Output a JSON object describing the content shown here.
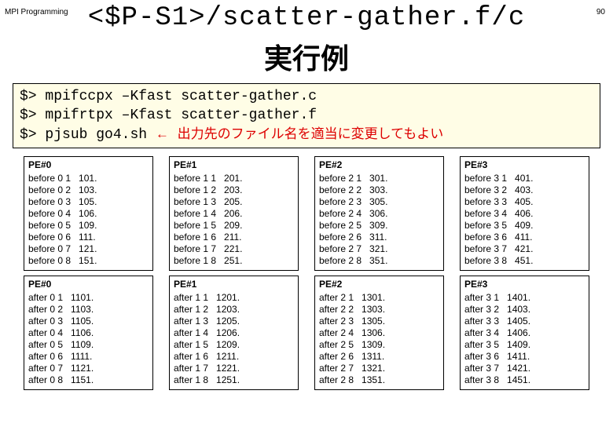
{
  "header": {
    "label": "MPI Programming",
    "page_number": "90"
  },
  "title": {
    "path": "<$P-S1>/scatter-gather.f/c",
    "jp": "実行例"
  },
  "commands": {
    "l1_prompt": "$>",
    "l1_cmd": "mpifccpx –Kfast scatter-gather.c",
    "l2_prompt": "$>",
    "l2_cmd": "mpifrtpx –Kfast scatter-gather.f",
    "l3_prompt": "$>",
    "l3_cmd": "pjsub go4.sh",
    "l3_arrow": "←",
    "l3_note": "出力先のファイル名を適当に変更してもよい"
  },
  "before": {
    "pe0": {
      "title": "PE#0",
      "rows": [
        "before 0 1   101.",
        "before 0 2   103.",
        "before 0 3   105.",
        "before 0 4   106.",
        "before 0 5   109.",
        "before 0 6   111.",
        "before 0 7   121.",
        "before 0 8   151."
      ]
    },
    "pe1": {
      "title": "PE#1",
      "rows": [
        "before 1 1   201.",
        "before 1 2   203.",
        "before 1 3   205.",
        "before 1 4   206.",
        "before 1 5   209.",
        "before 1 6   211.",
        "before 1 7   221.",
        "before 1 8   251."
      ]
    },
    "pe2": {
      "title": "PE#2",
      "rows": [
        "before 2 1   301.",
        "before 2 2   303.",
        "before 2 3   305.",
        "before 2 4   306.",
        "before 2 5   309.",
        "before 2 6   311.",
        "before 2 7   321.",
        "before 2 8   351."
      ]
    },
    "pe3": {
      "title": "PE#3",
      "rows": [
        "before 3 1   401.",
        "before 3 2   403.",
        "before 3 3   405.",
        "before 3 4   406.",
        "before 3 5   409.",
        "before 3 6   411.",
        "before 3 7   421.",
        "before 3 8   451."
      ]
    }
  },
  "after": {
    "pe0": {
      "title": "PE#0",
      "rows": [
        "after 0 1   1101.",
        "after 0 2   1103.",
        "after 0 3   1105.",
        "after 0 4   1106.",
        "after 0 5   1109.",
        "after 0 6   1111.",
        "after 0 7   1121.",
        "after 0 8   1151."
      ]
    },
    "pe1": {
      "title": "PE#1",
      "rows": [
        "after 1 1   1201.",
        "after 1 2   1203.",
        "after 1 3   1205.",
        "after 1 4   1206.",
        "after 1 5   1209.",
        "after 1 6   1211.",
        "after 1 7   1221.",
        "after 1 8   1251."
      ]
    },
    "pe2": {
      "title": "PE#2",
      "rows": [
        "after 2 1   1301.",
        "after 2 2   1303.",
        "after 2 3   1305.",
        "after 2 4   1306.",
        "after 2 5   1309.",
        "after 2 6   1311.",
        "after 2 7   1321.",
        "after 2 8   1351."
      ]
    },
    "pe3": {
      "title": "PE#3",
      "rows": [
        "after 3 1   1401.",
        "after 3 2   1403.",
        "after 3 3   1405.",
        "after 3 4   1406.",
        "after 3 5   1409.",
        "after 3 6   1411.",
        "after 3 7   1421.",
        "after 3 8   1451."
      ]
    }
  }
}
